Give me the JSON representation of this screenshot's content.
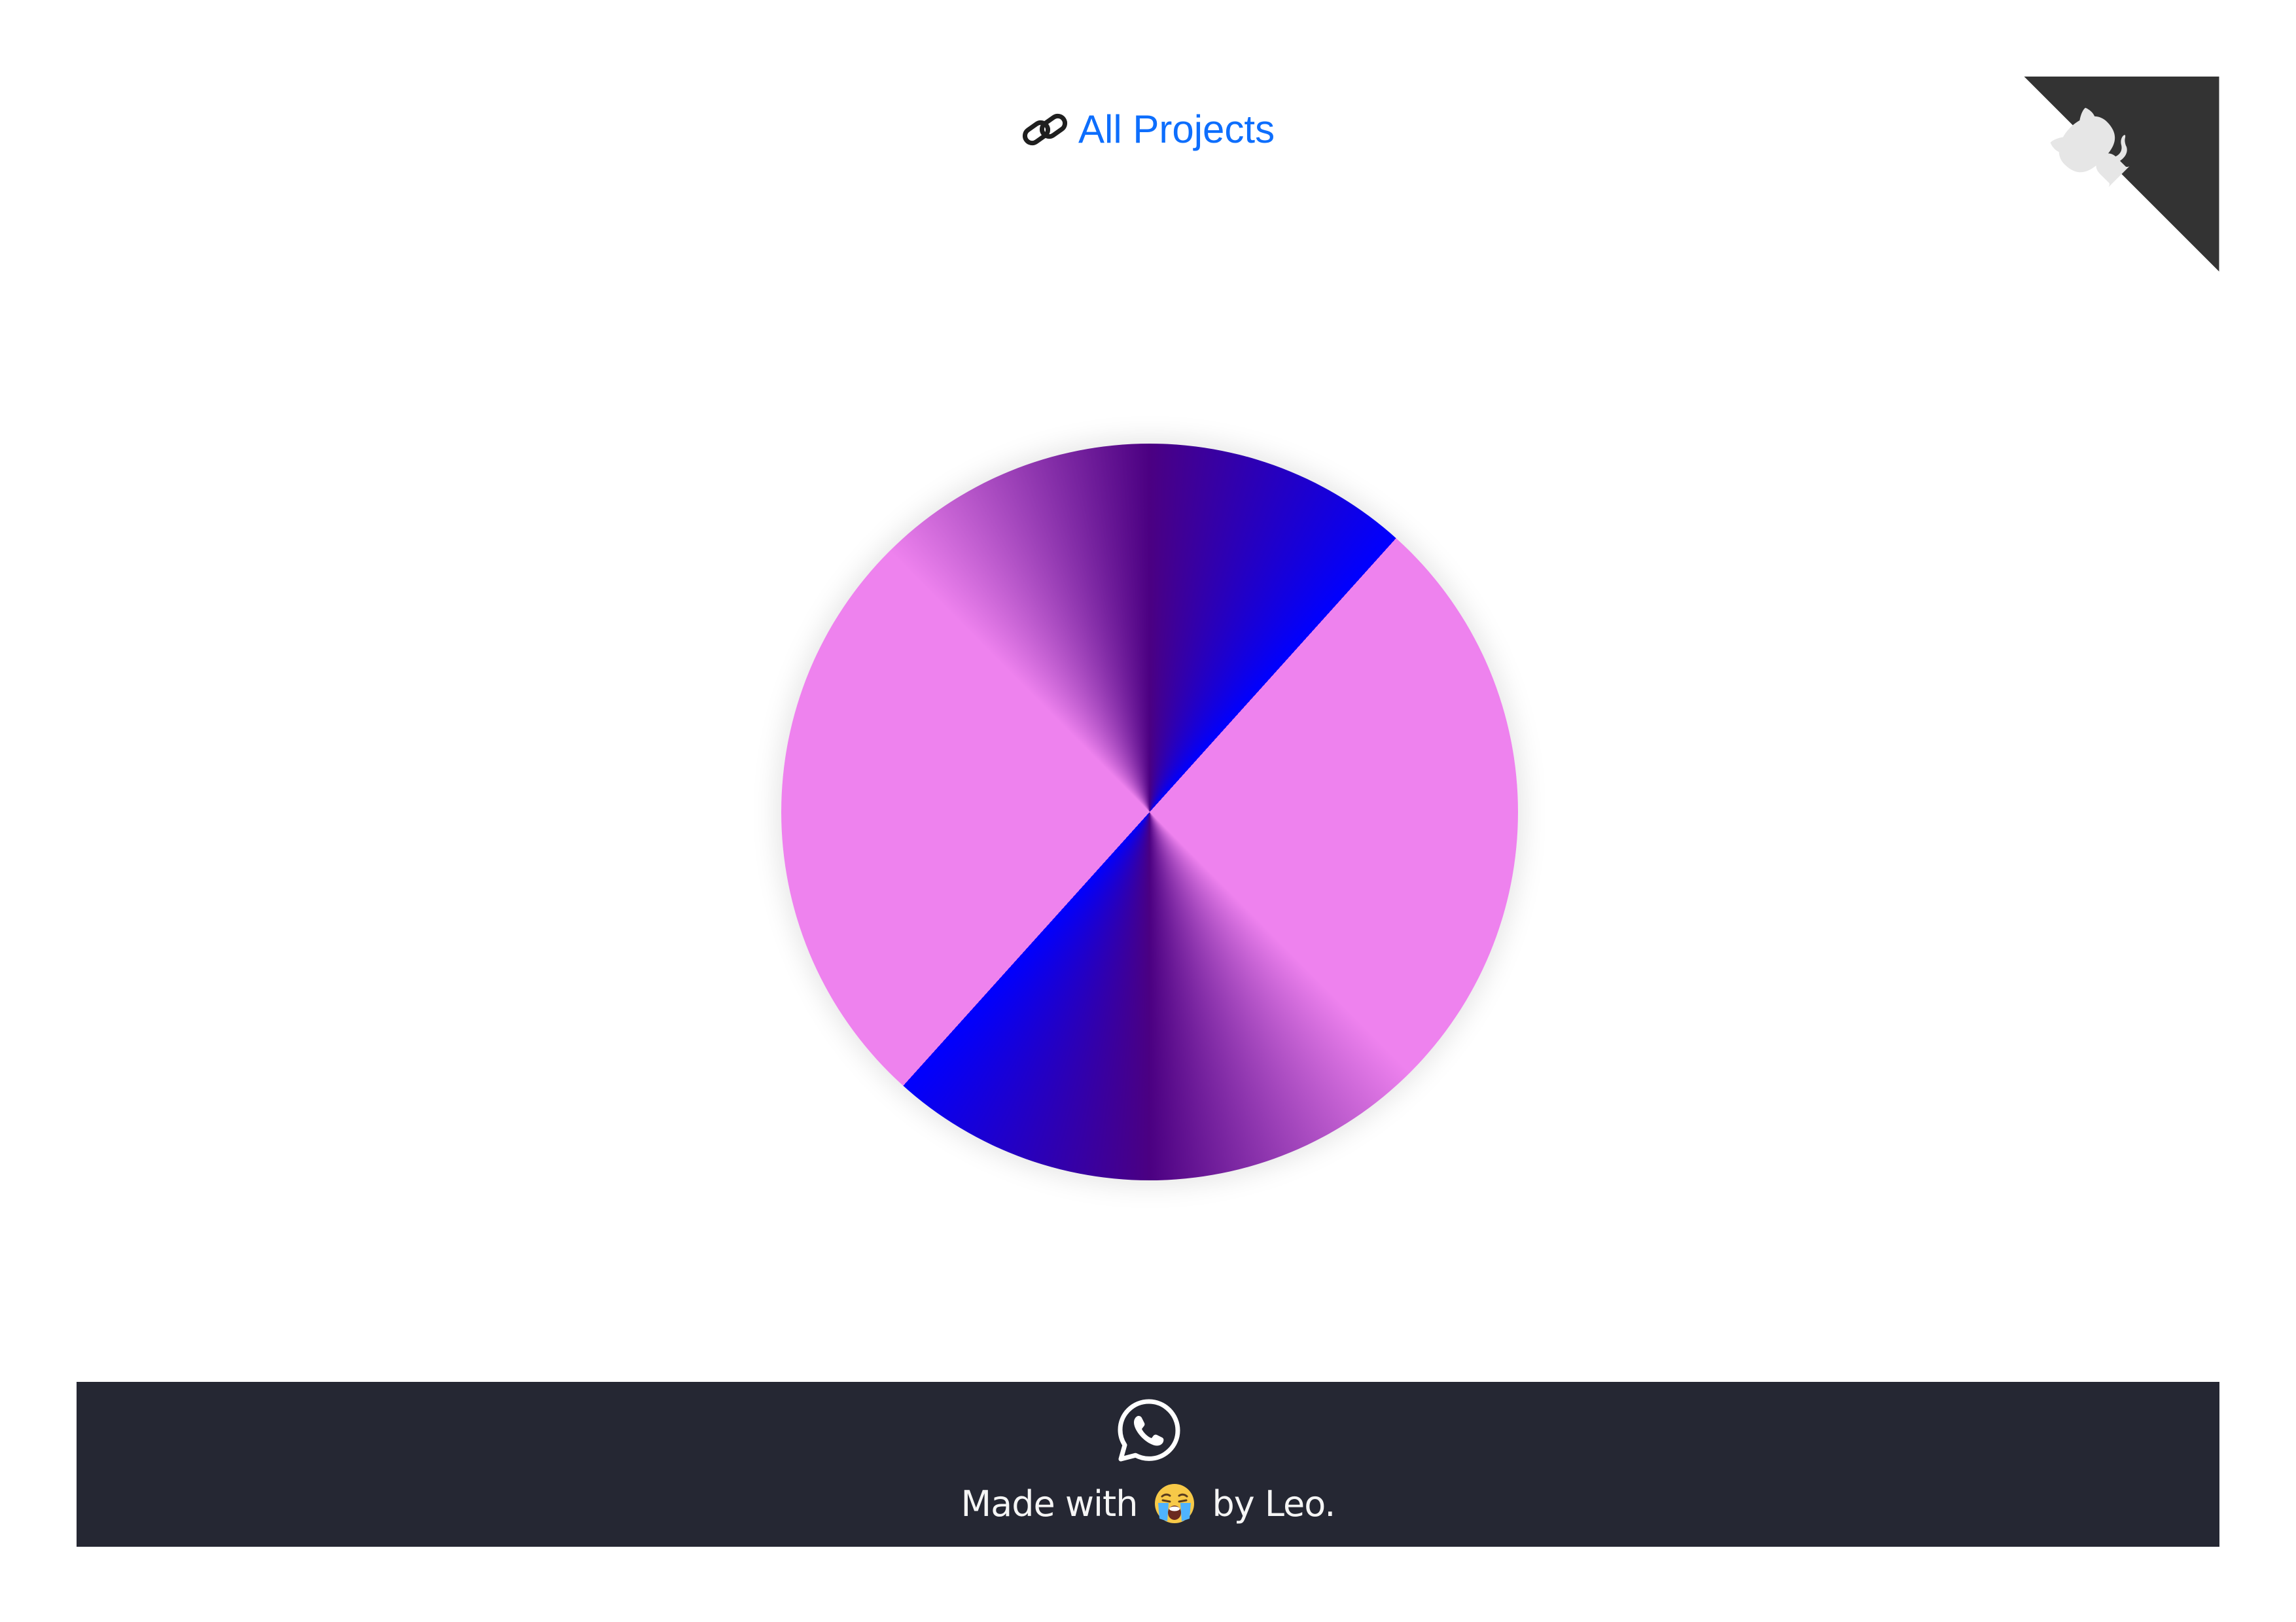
{
  "header": {
    "link_label": "All Projects",
    "link_icon": "link-icon"
  },
  "github_corner": {
    "icon": "github-octocat-icon"
  },
  "gradient": {
    "colors": [
      "#ee82ee",
      "#4b0082",
      "#0000ff"
    ]
  },
  "footer": {
    "contact_icon": "whatsapp-icon",
    "credit_prefix": "Made with",
    "credit_emoji": "crying-face-emoji",
    "credit_suffix": "by Leo."
  }
}
